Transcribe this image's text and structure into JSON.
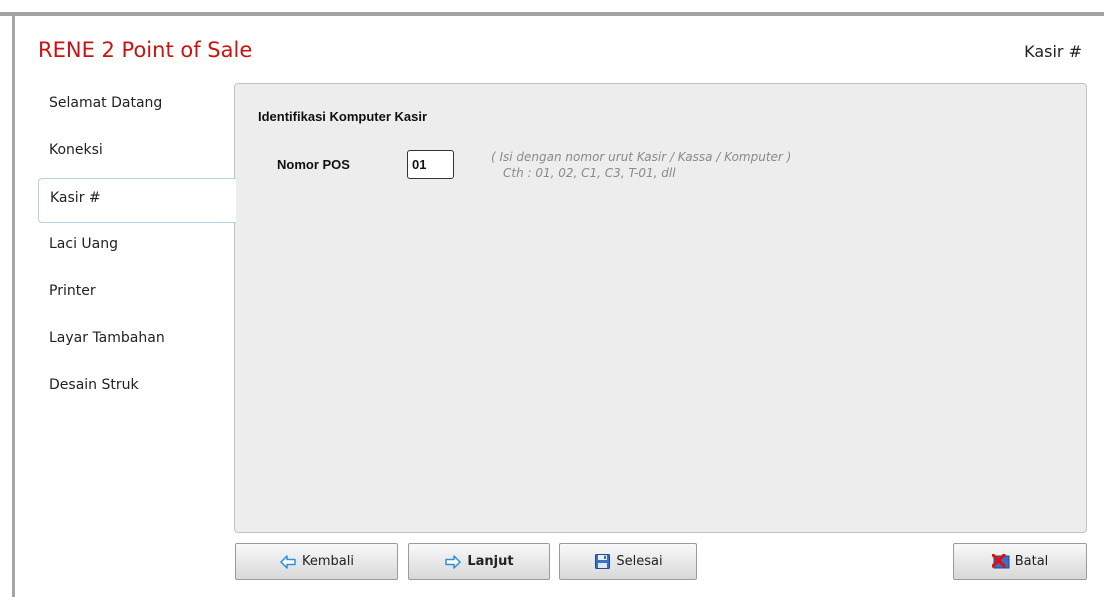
{
  "app": {
    "title": "RENE 2 Point of Sale",
    "page_label": "Kasir #"
  },
  "nav": {
    "items": [
      {
        "label": "Selamat Datang"
      },
      {
        "label": "Koneksi"
      },
      {
        "label": "Kasir #"
      },
      {
        "label": "Laci Uang"
      },
      {
        "label": "Printer"
      },
      {
        "label": "Layar Tambahan"
      },
      {
        "label": "Desain Struk"
      }
    ],
    "active": "Kasir #"
  },
  "panel": {
    "section_title": "Identifikasi Komputer Kasir",
    "pos_label": "Nomor POS",
    "pos_value": "01",
    "hint_line1": "( Isi dengan nomor urut Kasir / Kassa / Komputer )",
    "hint_line2": "Cth  : 01, 02, C1, C3, T-01, dll"
  },
  "buttons": {
    "back": "Kembali",
    "next": "Lanjut",
    "finish": "Selesai",
    "cancel": "Batal"
  },
  "icons": {
    "back": "arrow-left-icon",
    "next": "arrow-right-icon",
    "finish": "floppy-disk-icon",
    "cancel": "cancel-x-icon"
  },
  "colors": {
    "title": "#cc1111",
    "panel": "#ededed",
    "arrow": "#2f8fd8"
  }
}
